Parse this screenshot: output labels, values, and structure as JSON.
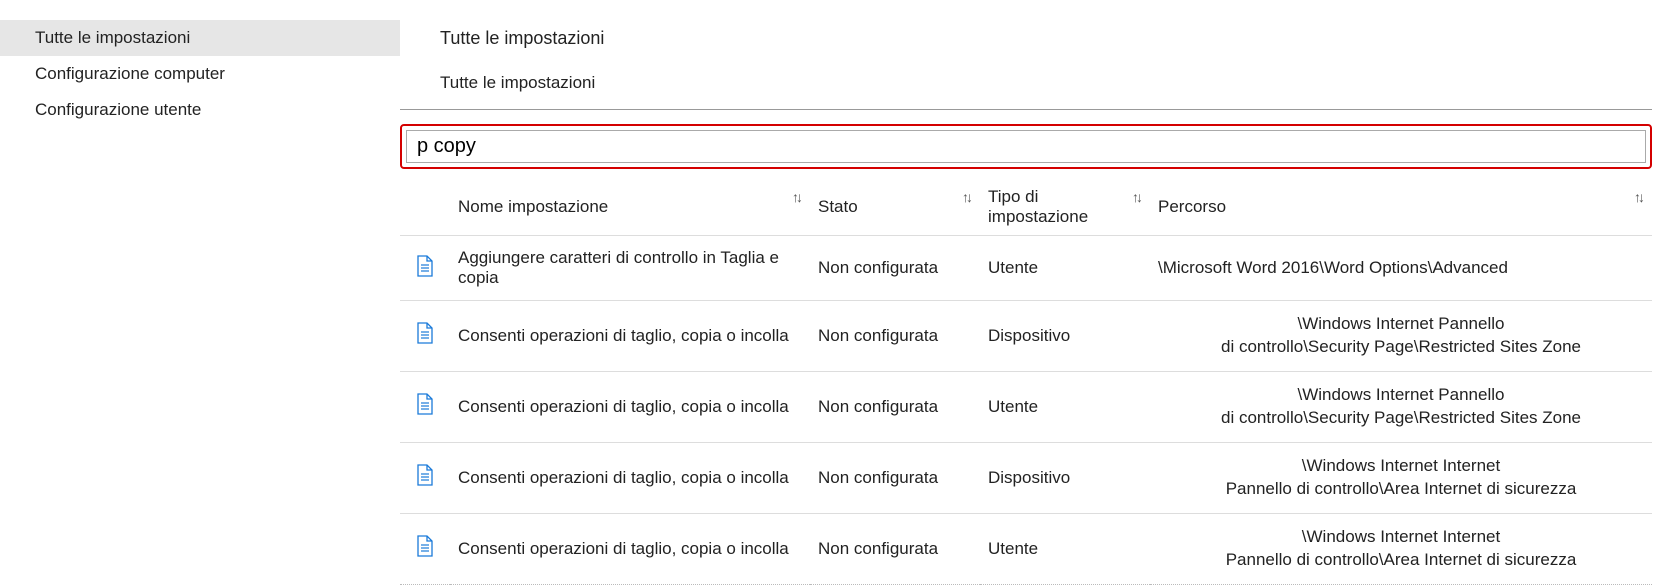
{
  "sidebar": {
    "items": [
      {
        "label": "Tutte le impostazioni",
        "selected": true
      },
      {
        "label": "Configurazione computer",
        "selected": false
      },
      {
        "label": "Configurazione utente",
        "selected": false
      }
    ]
  },
  "header": {
    "title": "Tutte le impostazioni",
    "breadcrumb": "Tutte le impostazioni"
  },
  "search": {
    "value": "p copy"
  },
  "table": {
    "columns": {
      "name": "Nome impostazione",
      "state": "Stato",
      "type": "Tipo di impostazione",
      "path": "Percorso"
    },
    "rows": [
      {
        "name": "Aggiungere caratteri di controllo in Taglia e copia",
        "state": "Non configurata",
        "type": "Utente",
        "path_l1": "\\Microsoft Word 2016\\Word Options\\Advanced",
        "path_l2": ""
      },
      {
        "name": "Consenti operazioni di taglio, copia o incolla",
        "state": "Non configurata",
        "type": "Dispositivo",
        "path_l1": "\\Windows Internet Pannello",
        "path_l2": "di controllo\\Security Page\\Restricted Sites Zone"
      },
      {
        "name": "Consenti operazioni di taglio, copia o incolla",
        "state": "Non configurata",
        "type": "Utente",
        "path_l1": "\\Windows Internet Pannello",
        "path_l2": "di controllo\\Security Page\\Restricted Sites Zone"
      },
      {
        "name": "Consenti operazioni di taglio, copia o incolla",
        "state": "Non configurata",
        "type": "Dispositivo",
        "path_l1": "\\Windows Internet Internet",
        "path_l2": "Pannello di controllo\\Area Internet di sicurezza"
      },
      {
        "name": "Consenti operazioni di taglio, copia o incolla",
        "state": "Non configurata",
        "type": "Utente",
        "path_l1": "\\Windows Internet Internet",
        "path_l2": "Pannello di controllo\\Area Internet di sicurezza"
      }
    ]
  }
}
